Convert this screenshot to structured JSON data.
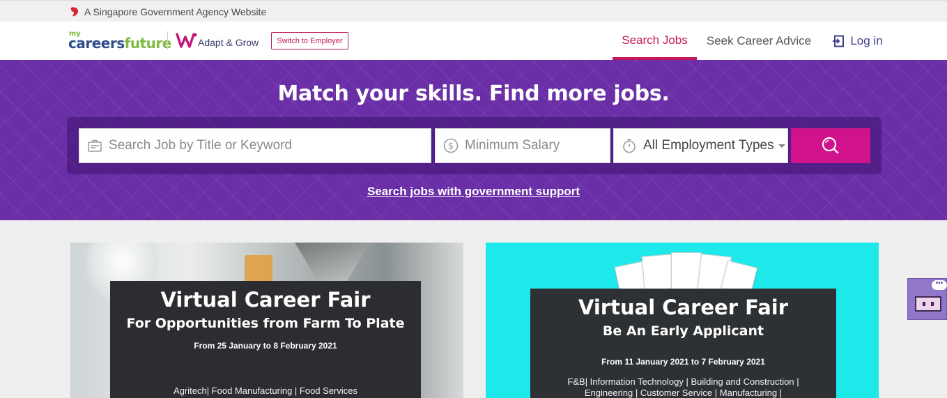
{
  "masthead": {
    "text": "A Singapore Government Agency Website",
    "icon": "lion-head-icon"
  },
  "header": {
    "logo_my": "my",
    "logo_careers": "careers",
    "logo_future": "future",
    "logo_adapt": "Adapt & Grow",
    "switch_label": "Switch to Employer",
    "nav": {
      "search": "Search Jobs",
      "advice": "Seek Career Advice",
      "login": "Log in"
    },
    "active_nav": "Search Jobs"
  },
  "hero": {
    "title": "Match your skills. Find more jobs.",
    "search": {
      "keyword_placeholder": "Search Job by Title or Keyword",
      "keyword_value": "",
      "salary_placeholder": "Minimum Salary",
      "salary_value": "",
      "employment_type": "All Employment Types"
    },
    "gov_link": "Search jobs with government support"
  },
  "banners": [
    {
      "title": "Virtual Career Fair",
      "subtitle": "For Opportunities from Farm To Plate",
      "date": "From 25 January to 8 February 2021",
      "sectors": "Agritech| Food Manufacturing | Food Services"
    },
    {
      "title": "Virtual Career Fair",
      "subtitle": "Be An Early Applicant",
      "date": "From  11 January 2021 to 7 February 2021",
      "sectors": "F&B| Information Technology | Building and Construction |",
      "sectors2": "Engineering | Customer Service | Manufacturing |"
    }
  ],
  "colors": {
    "brand_purple": "#6a2ea7",
    "accent_magenta": "#d0138c",
    "nav_active": "#c2185b",
    "banner2_bg": "#1de8ea"
  }
}
